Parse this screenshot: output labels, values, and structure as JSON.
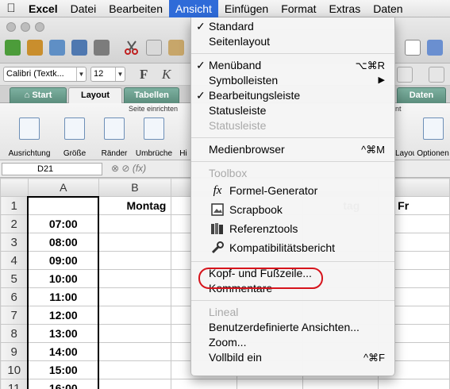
{
  "menubar": {
    "apple_icon": "apple-icon",
    "items": [
      {
        "label": "Excel",
        "bold": true
      },
      {
        "label": "Datei"
      },
      {
        "label": "Bearbeiten"
      },
      {
        "label": "Ansicht",
        "active": true
      },
      {
        "label": "Einfügen"
      },
      {
        "label": "Format"
      },
      {
        "label": "Extras"
      },
      {
        "label": "Daten"
      }
    ]
  },
  "fontbar": {
    "font_name": "Calibri (Textk...",
    "font_size": "12",
    "bold": "F",
    "italic": "K"
  },
  "ribbon": {
    "tabs": [
      "Start",
      "Layout",
      "Tabellen",
      "Daten"
    ],
    "selected_tab": "Layout",
    "group_title": "Seite einrichten",
    "buttons": [
      "Ausrichtung",
      "Größe",
      "Ränder",
      "Umbrüche",
      "Hi"
    ],
    "right_buttons": [
      "Layout",
      "Optionen"
    ],
    "right_group_title": "nt"
  },
  "formula_bar": {
    "cell_ref": "D21",
    "fx": "fx"
  },
  "sheet": {
    "columns": [
      "A",
      "B"
    ],
    "visible_headers": {
      "B1": "Montag",
      "E1": "tag",
      "F1": "Fr"
    },
    "rows": [
      {
        "n": "1",
        "a": ""
      },
      {
        "n": "2",
        "a": "07:00"
      },
      {
        "n": "3",
        "a": "08:00"
      },
      {
        "n": "4",
        "a": "09:00"
      },
      {
        "n": "5",
        "a": "10:00"
      },
      {
        "n": "6",
        "a": "11:00"
      },
      {
        "n": "7",
        "a": "12:00"
      },
      {
        "n": "8",
        "a": "13:00"
      },
      {
        "n": "9",
        "a": "14:00"
      },
      {
        "n": "10",
        "a": "15:00"
      },
      {
        "n": "11",
        "a": "16:00"
      }
    ]
  },
  "view_menu": {
    "standard": "Standard",
    "seitenlayout": "Seitenlayout",
    "menueband": "Menüband",
    "menueband_sc": "⌥⌘R",
    "symbolleisten": "Symbolleisten",
    "symbolleisten_arrow": "▶",
    "bearbeitungsleiste": "Bearbeitungsleiste",
    "statusleiste": "Statusleiste",
    "statusleiste_dis": "Statusleiste",
    "medienbrowser": "Medienbrowser",
    "medienbrowser_sc": "^⌘M",
    "toolbox": "Toolbox",
    "formel_generator": "Formel-Generator",
    "scrapbook": "Scrapbook",
    "referenztools": "Referenztools",
    "kompatibilitaet": "Kompatibilitätsbericht",
    "kopf_fuss": "Kopf- und Fußzeile...",
    "kommentare": "Kommentare",
    "lineal": "Lineal",
    "benutzerdef": "Benutzerdefinierte Ansichten...",
    "zoom": "Zoom...",
    "vollbild": "Vollbild ein",
    "vollbild_sc": "^⌘F",
    "check": "✓",
    "fx_glyph": "fx"
  },
  "colors": {
    "menu_active": "#2f6bd8",
    "highlight_ring": "#d6141c",
    "ribbon_tab": "#6b9c8b"
  }
}
